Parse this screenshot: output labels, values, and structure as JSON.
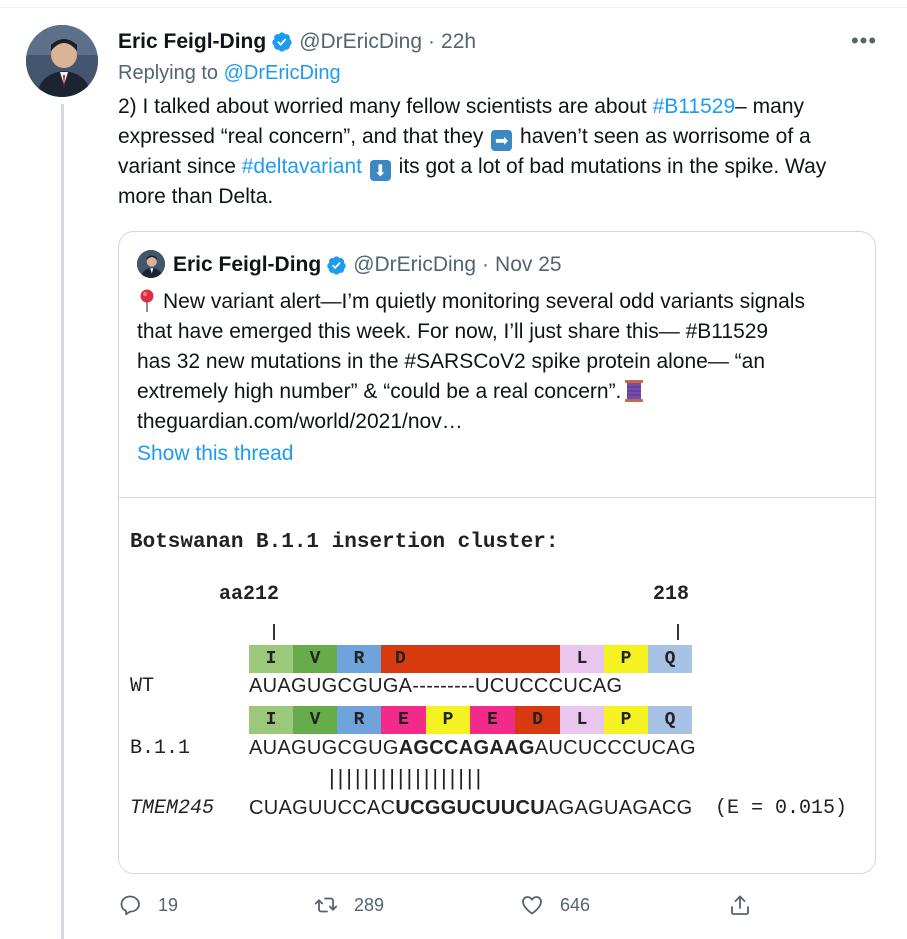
{
  "tweet": {
    "author_name": "Eric Feigl-Ding",
    "author_handle": "@DrEricDing",
    "separator": "·",
    "time": "22h",
    "more_label": "•••",
    "replying_prefix": "Replying to",
    "replying_to": "@DrEricDing",
    "text": {
      "part1": "2) I talked about worried many fellow scientists are about ",
      "hashtag1": "#B11529",
      "part2": "– many expressed “real concern”, and that they ",
      "emoji1": "➡",
      "part3": " haven’t seen as worrisome of a variant since ",
      "hashtag2": "#deltavariant",
      "emoji2": "⬇",
      "part4": " its got a lot of bad mutations in the spike. Way more than Delta."
    }
  },
  "quoted": {
    "author_name": "Eric Feigl-Ding",
    "author_handle": "@DrEricDing",
    "separator": "·",
    "time": "Nov 25",
    "line1": "New variant alert—I’m quietly monitoring several odd variants signals",
    "line2": "that have emerged this week. For now, I’ll just share this— #B11529",
    "line3": "has 32 new mutations in the #SARSCoV2 spike protein alone— “an",
    "line4": "extremely high number” & “could be a real concern”.",
    "line5": "theguardian.com/world/2021/nov…",
    "show_thread": "Show this thread"
  },
  "figure": {
    "title": "Botswanan B.1.1 insertion cluster:",
    "aa_start": "aa212",
    "aa_end": "218",
    "wt_label": "WT",
    "wt_seq": "AUAGUGCGUGA---------UCUCCCUCAG",
    "b11_label": "B.1.1",
    "b11_seq_plain1": "AUAGUGCGUG",
    "b11_seq_bold": "AGCCAGAAG",
    "b11_seq_plain2": "AUCUCCCUCAG",
    "bars": "||||||||||||||||||",
    "tmem_label": "TMEM245",
    "tmem_seq_plain1": "CUAGUUCCAC",
    "tmem_seq_bold": "UCGGUCUUCU",
    "tmem_seq_plain2": "AGAGUAGACG",
    "evalue": "(E = 0.015)",
    "wt_cells": [
      {
        "aa": "I",
        "color": "#9bc87a"
      },
      {
        "aa": "V",
        "color": "#67ac4a"
      },
      {
        "aa": "R",
        "color": "#6fa3dc"
      },
      {
        "aa": "D",
        "color": "#d83a10"
      },
      {
        "aa": "L",
        "color": "#e8c6ee"
      },
      {
        "aa": "P",
        "color": "#f5f222"
      },
      {
        "aa": "Q",
        "color": "#a8c2e6"
      }
    ],
    "b11_cells": [
      {
        "aa": "I",
        "color": "#9bc87a"
      },
      {
        "aa": "V",
        "color": "#67ac4a"
      },
      {
        "aa": "R",
        "color": "#6fa3dc"
      },
      {
        "aa": "E",
        "color": "#f32a8a"
      },
      {
        "aa": "P",
        "color": "#f5f222"
      },
      {
        "aa": "E",
        "color": "#f32a8a"
      },
      {
        "aa": "D",
        "color": "#d83a10"
      },
      {
        "aa": "L",
        "color": "#e8c6ee"
      },
      {
        "aa": "P",
        "color": "#f5f222"
      },
      {
        "aa": "Q",
        "color": "#a8c2e6"
      }
    ]
  },
  "actions": {
    "replies": "19",
    "retweets": "289",
    "likes": "646"
  },
  "colors": {
    "accent": "#1d9bf0",
    "secondary_text": "#536471",
    "border": "#cfd9de"
  }
}
